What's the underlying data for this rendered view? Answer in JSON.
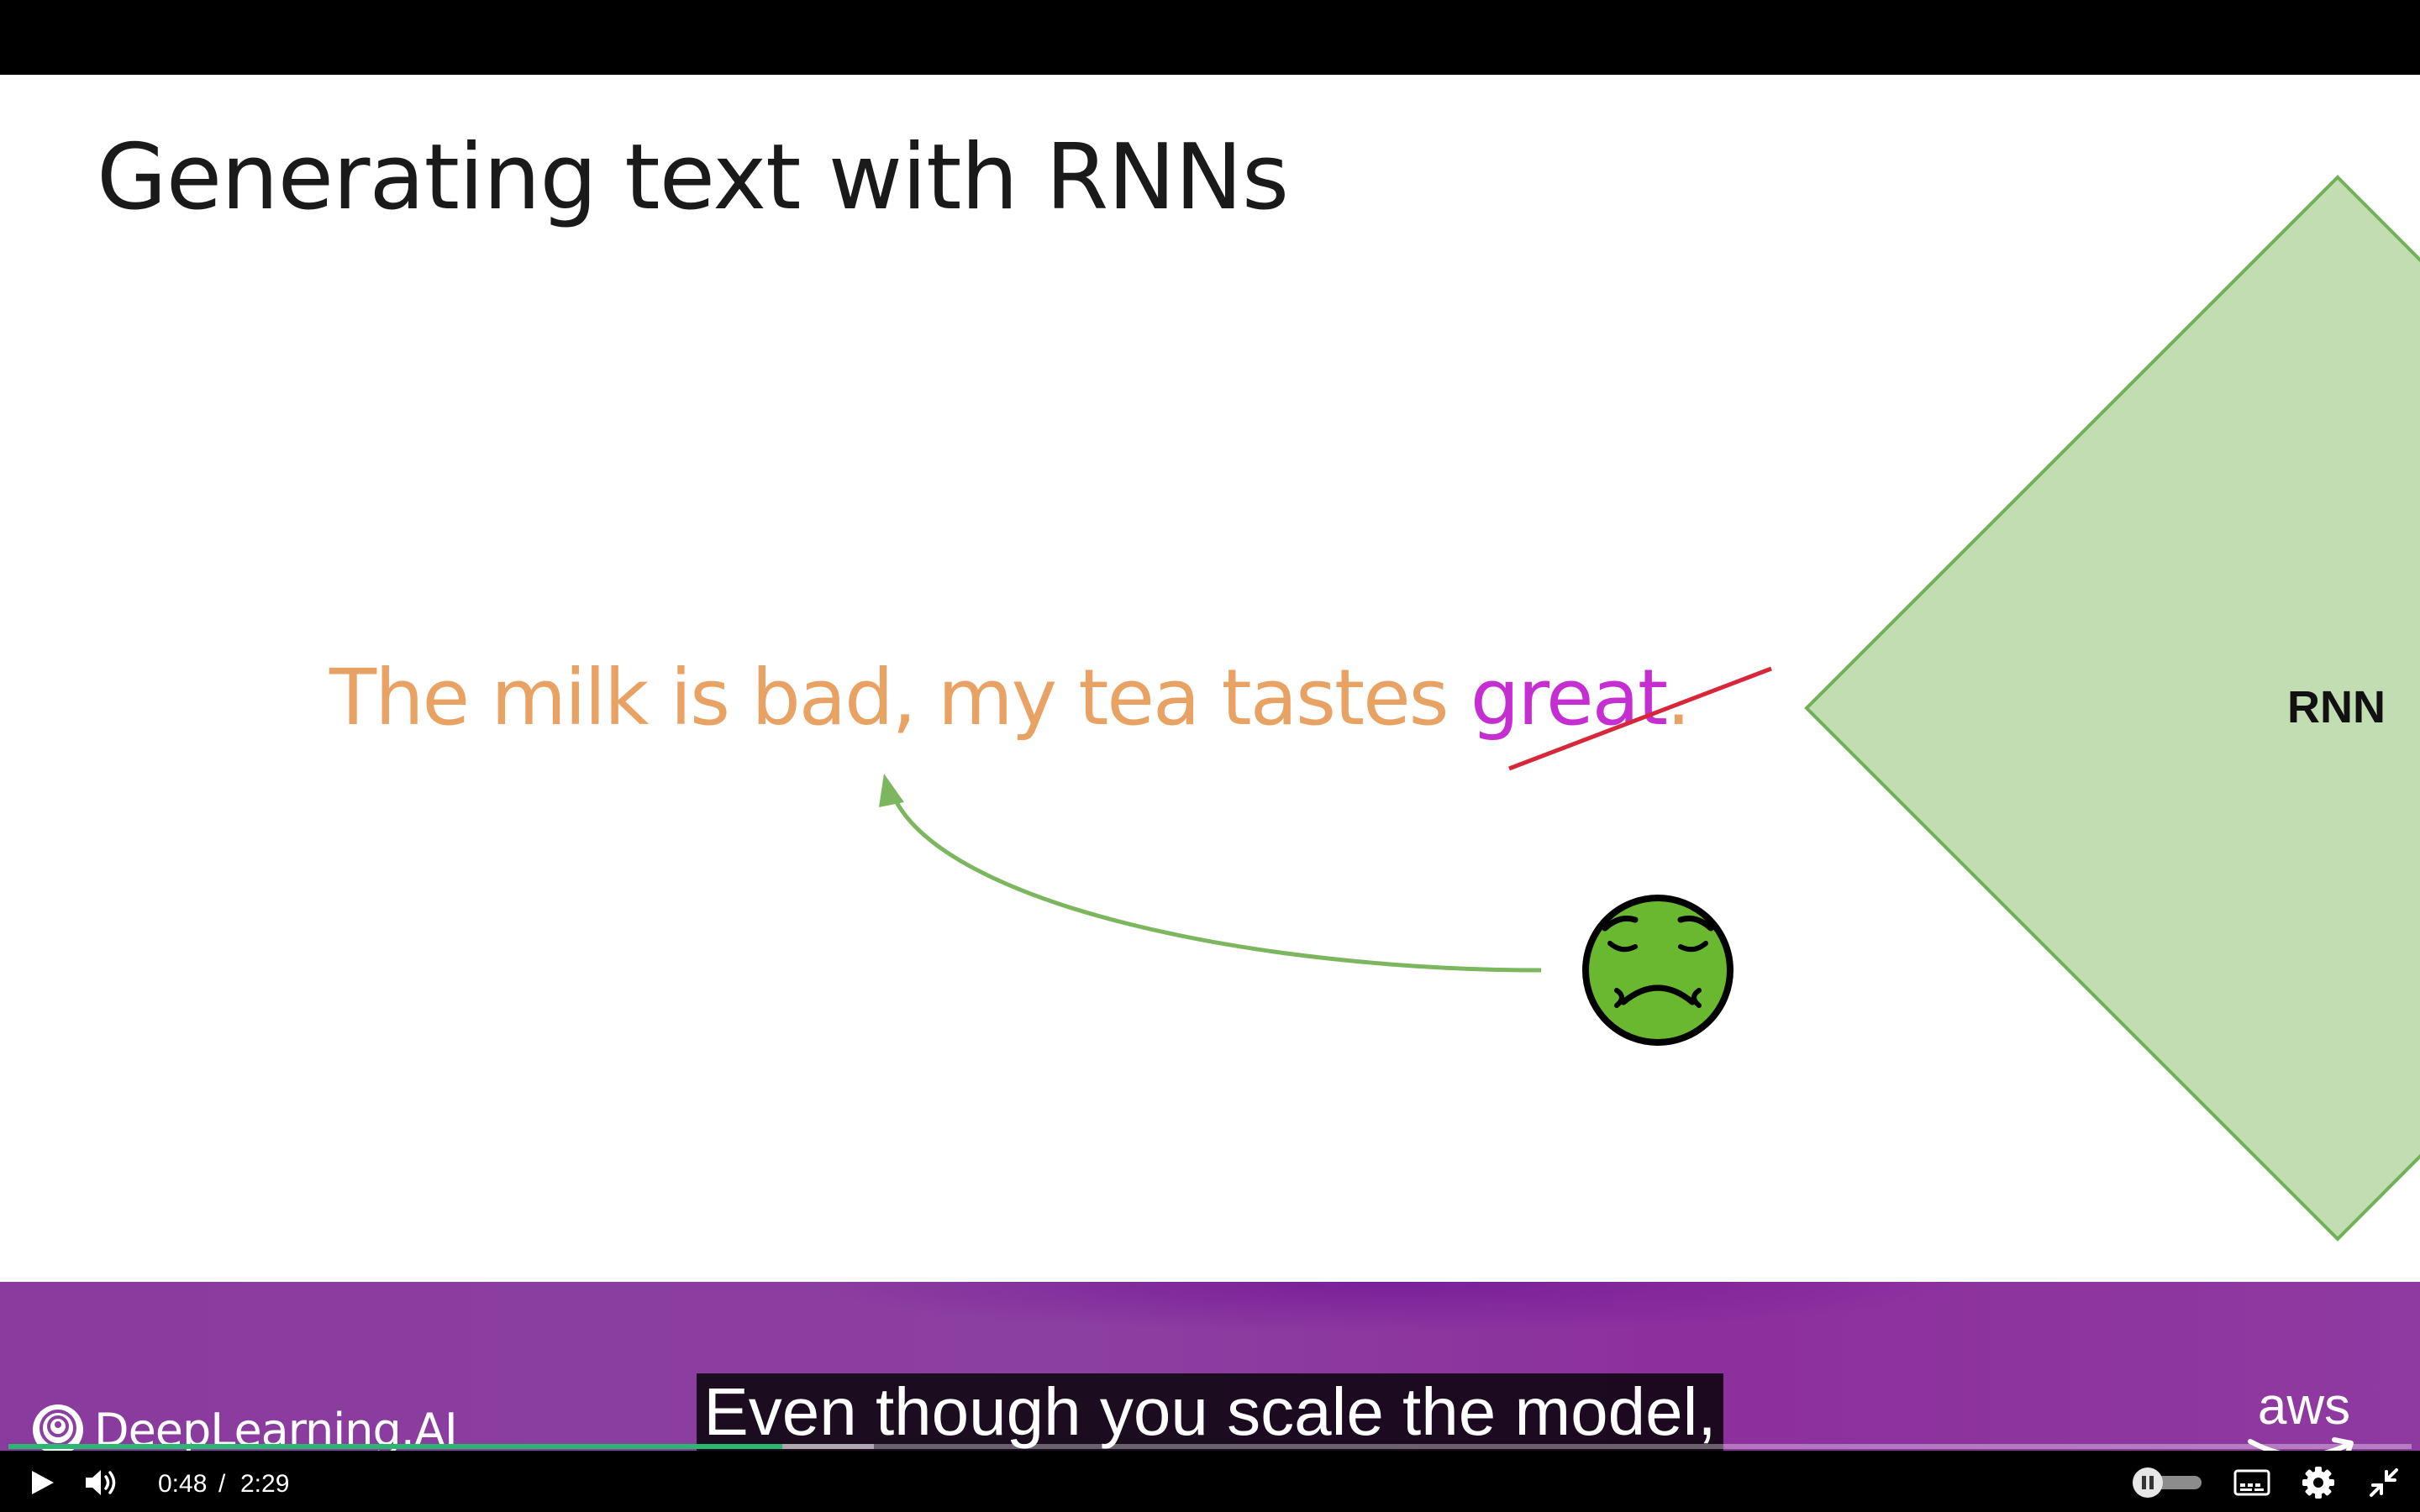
{
  "slide": {
    "title": "Generating text with RNNs",
    "sentence_main": "The milk is bad, my tea tastes ",
    "sentence_struck": "great",
    "sentence_end": ".",
    "rnn_label": "RNN",
    "emoji": "nauseated-face-icon"
  },
  "branding": {
    "left_logo": "DeepLearning.AI",
    "right_logo": "aws"
  },
  "caption": "Even though you scale the model,",
  "player": {
    "current_time": "0:48",
    "separator": "/",
    "total_time": "2:29",
    "progress": 0.322,
    "buffered": 0.36,
    "icons": [
      "play-icon",
      "volume-icon",
      "autoplay-toggle-icon",
      "captions-icon",
      "settings-icon",
      "exit-fullscreen-icon"
    ]
  },
  "colors": {
    "sentence": "#e8a264",
    "struck_word": "#c52ed0",
    "strike": "#d6283a",
    "rnn_fill": "#c1ddb1",
    "rnn_stroke": "#6fb157",
    "arrow": "#7cb65e",
    "progress": "#2bb673",
    "footer": "#8b3fa0"
  }
}
